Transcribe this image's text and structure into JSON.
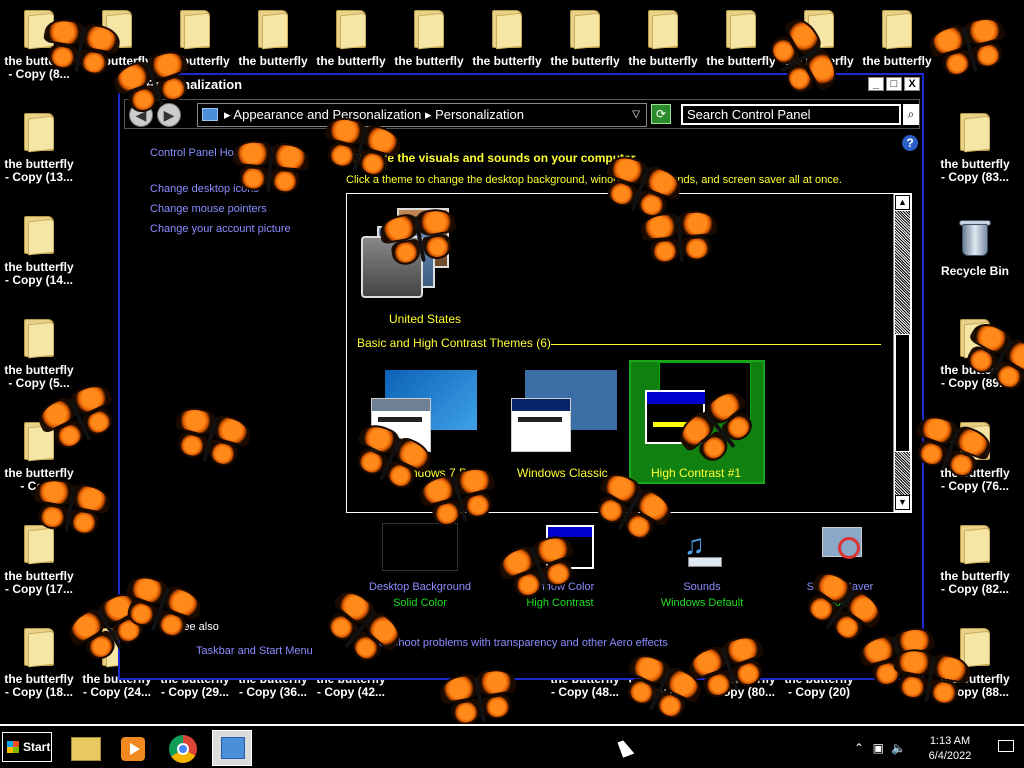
{
  "desktop": {
    "icons": [
      {
        "line1": "the butterfly",
        "line2": "- Copy (8..."
      },
      {
        "line1": "the butterfly",
        "line2": "- Copy (13..."
      },
      {
        "line1": "the butterfly",
        "line2": "- Copy (14..."
      },
      {
        "line1": "the butterfly",
        "line2": "- Copy (5..."
      },
      {
        "line1": "the butterfly",
        "line2": "- Copy"
      },
      {
        "line1": "the butterfly",
        "line2": "- Copy (17..."
      },
      {
        "line1": "the butterfly",
        "line2": "- Copy (18..."
      },
      {
        "line1": "the butterfly",
        "line2": "- Copy (24..."
      },
      {
        "line1": "the butterfly",
        "line2": "- Copy (29..."
      },
      {
        "line1": "the butterfly",
        "line2": "- Copy (36..."
      },
      {
        "line1": "the butterfly",
        "line2": "- Copy (42..."
      },
      {
        "line1": "the butterfly",
        "line2": "- Copy (48..."
      },
      {
        "line1": "the butterfly",
        "line2": "- Copy (67..."
      },
      {
        "line1": "the butterfly",
        "line2": "- Copy (80..."
      },
      {
        "line1": "the butterfly",
        "line2": "- Copy (20)"
      },
      {
        "line1": "the butterfly",
        "line2": "- Copy (88..."
      },
      {
        "line1": "the butterfly",
        "line2": "- Copy (83..."
      },
      {
        "line1": "the butterfly",
        "line2": "- Copy (89..."
      },
      {
        "line1": "the butterfly",
        "line2": "- Copy (76..."
      },
      {
        "line1": "the butterfly",
        "line2": "- Copy (82..."
      }
    ],
    "top_row_label": "the butterfly",
    "recycle_bin": "Recycle Bin"
  },
  "window": {
    "title": "Personalization",
    "buttons": {
      "minimize": "_",
      "maximize": "□",
      "close": "X"
    },
    "breadcrumb": [
      "Appearance and Personalization",
      "Personalization"
    ],
    "search_placeholder": "Search Control Panel",
    "help": "?"
  },
  "leftnav": {
    "home": "Control Panel Home",
    "links": [
      "Change desktop icons",
      "Change mouse pointers",
      "Change your account picture"
    ]
  },
  "main": {
    "heading": "Change the visuals and sounds on your computer",
    "subhead": "Click a theme to change the desktop background, window color, sounds, and screen saver all at once.",
    "my_theme": "United States",
    "group_label": "Basic and High Contrast Themes (6)",
    "themes": [
      "Windows 7 Basic",
      "Windows Classic",
      "High Contrast #1"
    ],
    "bottom": [
      {
        "title": "Desktop Background",
        "value": "Solid Color"
      },
      {
        "title": "Window Color",
        "value": "High Contrast"
      },
      {
        "title": "Sounds",
        "value": "Windows Default"
      },
      {
        "title": "Screen Saver",
        "value": "None"
      }
    ],
    "see_also": "See also",
    "taskbar_link": "Taskbar and Start Menu",
    "aero_link": "Troubleshoot problems with transparency and other Aero effects"
  },
  "taskbar": {
    "start": "Start",
    "time": "1:13 AM",
    "date": "6/4/2022"
  }
}
